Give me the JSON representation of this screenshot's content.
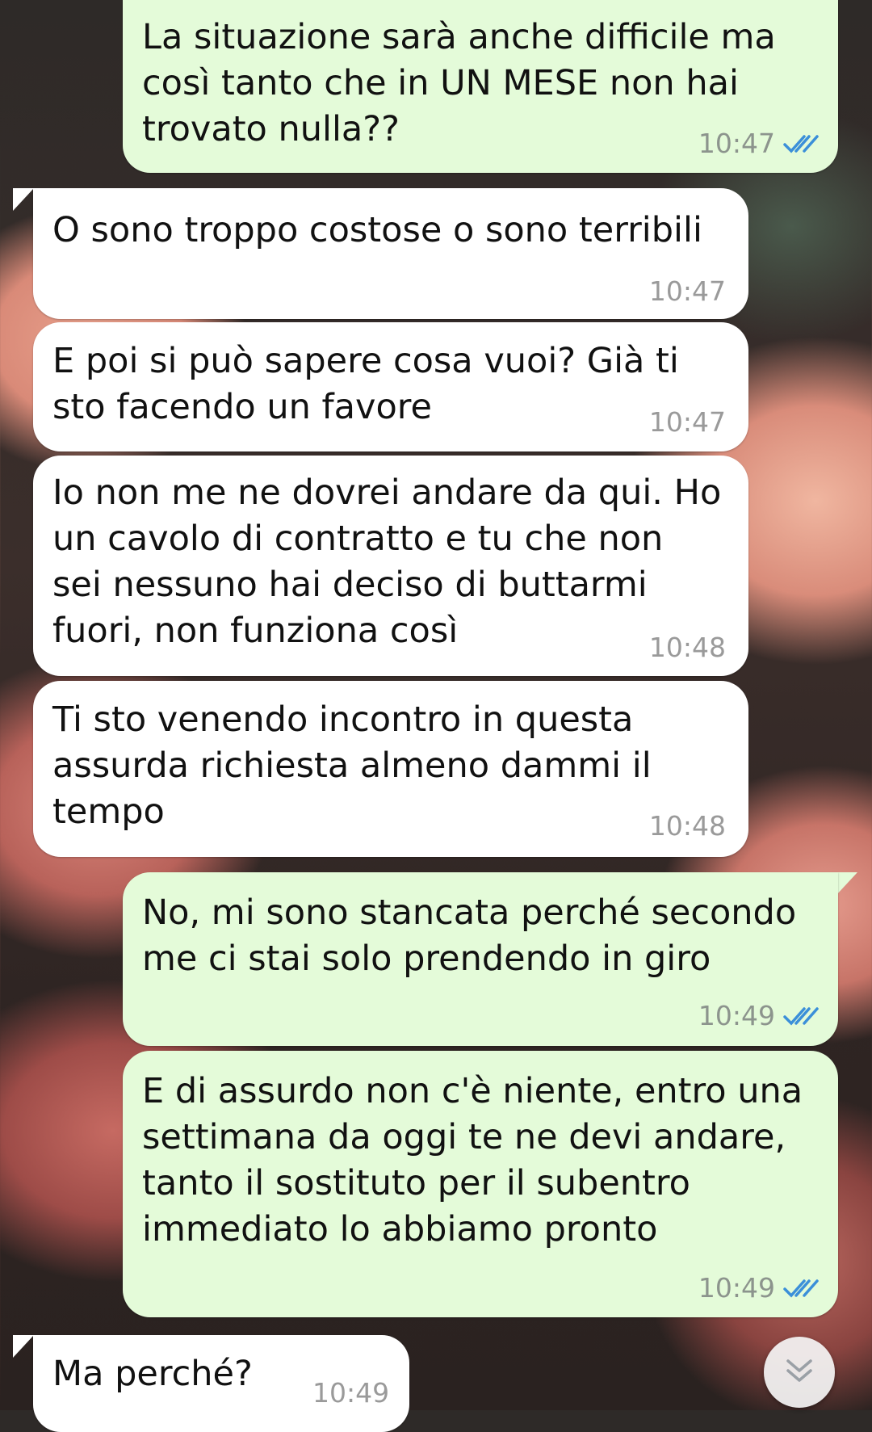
{
  "messages": [
    {
      "text": "La situazione sarà anche difficile ma\ncosì tanto che in UN MESE non hai\ntrovato nulla??",
      "time": "10:47",
      "direction": "outgoing",
      "status": "read"
    },
    {
      "text": "O sono troppo costose o sono terribili",
      "time": "10:47",
      "direction": "incoming"
    },
    {
      "text": "E poi si può sapere cosa vuoi? Già ti\nsto facendo un favore",
      "time": "10:47",
      "direction": "incoming"
    },
    {
      "text": "Io non me ne dovrei andare da qui. Ho\nun cavolo di contratto e tu che non\nsei nessuno hai deciso di buttarmi\nfuori, non funziona così",
      "time": "10:48",
      "direction": "incoming"
    },
    {
      "text": "Ti sto venendo incontro in questa\nassurda richiesta almeno dammi il\ntempo",
      "time": "10:48",
      "direction": "incoming"
    },
    {
      "text": "No, mi sono stancata perché secondo\nme ci stai solo prendendo in giro",
      "time": "10:49",
      "direction": "outgoing",
      "status": "read"
    },
    {
      "text": "E di assurdo non c'è niente, entro una\nsettimana da oggi te ne devi andare,\ntanto il sostituto per il subentro\nimmediato lo abbiamo pronto",
      "time": "10:49",
      "direction": "outgoing",
      "status": "read"
    },
    {
      "text": "Ma perché?",
      "time": "10:49",
      "direction": "incoming"
    }
  ],
  "colors": {
    "outgoing_bubble": "#e4fbd9",
    "incoming_bubble": "#ffffff",
    "read_ticks": "#3b8fd9"
  },
  "icons": {
    "read_receipt": "double-check-icon",
    "scroll": "double-chevron-down-icon"
  }
}
